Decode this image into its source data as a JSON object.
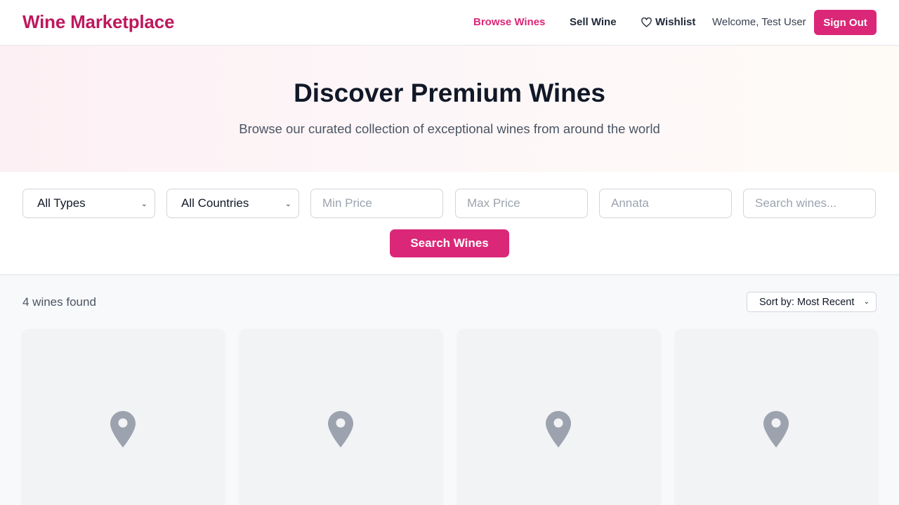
{
  "header": {
    "brand": "Wine Marketplace",
    "nav": {
      "browse": "Browse Wines",
      "sell": "Sell Wine",
      "wishlist": "Wishlist"
    },
    "welcome": "Welcome, Test User",
    "signout": "Sign Out"
  },
  "hero": {
    "title": "Discover Premium Wines",
    "subtitle": "Browse our curated collection of exceptional wines from around the world"
  },
  "filters": {
    "type_select": "All Types",
    "country_select": "All Countries",
    "min_price_placeholder": "Min Price",
    "max_price_placeholder": "Max Price",
    "vintage_placeholder": "Annata",
    "search_placeholder": "Search wines...",
    "search_button": "Search Wines"
  },
  "results": {
    "count": "4 wines found",
    "sort": "Sort by: Most Recent",
    "cards": [
      {
        "image": "location-pin-icon"
      },
      {
        "image": "location-pin-icon"
      },
      {
        "image": "location-pin-icon"
      },
      {
        "image": "location-pin-icon"
      }
    ]
  },
  "colors": {
    "accent": "#db2777",
    "brand": "#be185d"
  }
}
